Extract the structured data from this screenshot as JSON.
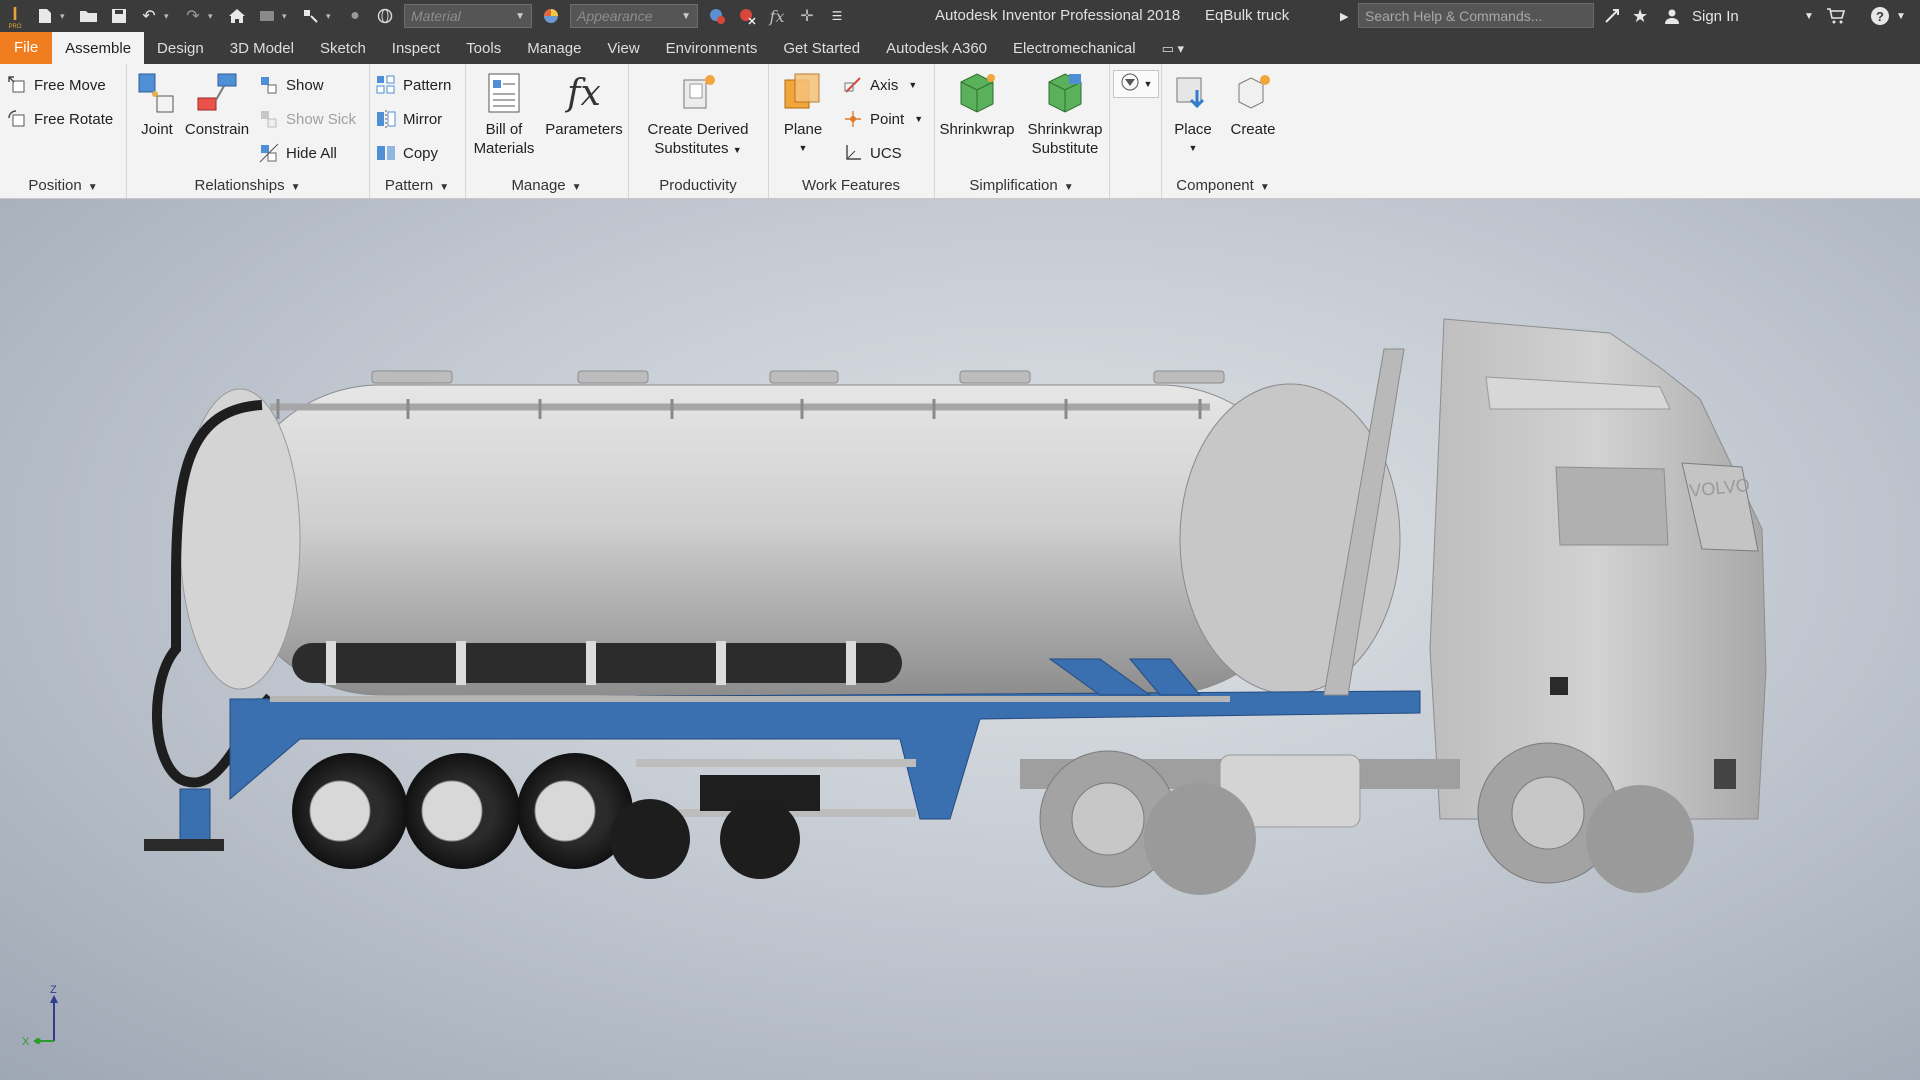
{
  "titlebar": {
    "app_title": "Autodesk Inventor Professional 2018",
    "doc_name": "EqBulk truck",
    "material_placeholder": "Material",
    "appearance_placeholder": "Appearance",
    "search_placeholder": "Search Help & Commands...",
    "sign_in": "Sign In",
    "logo_text": "PRO"
  },
  "tabs": [
    {
      "label": "File"
    },
    {
      "label": "Assemble"
    },
    {
      "label": "Design"
    },
    {
      "label": "3D Model"
    },
    {
      "label": "Sketch"
    },
    {
      "label": "Inspect"
    },
    {
      "label": "Tools"
    },
    {
      "label": "Manage"
    },
    {
      "label": "View"
    },
    {
      "label": "Environments"
    },
    {
      "label": "Get Started"
    },
    {
      "label": "Autodesk A360"
    },
    {
      "label": "Electromechanical"
    }
  ],
  "ribbon": {
    "position": {
      "title": "Position",
      "free_move": "Free Move",
      "free_rotate": "Free Rotate"
    },
    "relationships": {
      "title": "Relationships",
      "joint": "Joint",
      "constrain": "Constrain",
      "show": "Show",
      "show_sick": "Show Sick",
      "hide_all": "Hide All"
    },
    "pattern": {
      "title": "Pattern",
      "pattern": "Pattern",
      "mirror": "Mirror",
      "copy": "Copy"
    },
    "manage": {
      "title": "Manage",
      "bom_line1": "Bill of",
      "bom_line2": "Materials",
      "parameters": "Parameters"
    },
    "productivity": {
      "title": "Productivity",
      "cds_line1": "Create Derived",
      "cds_line2": "Substitutes"
    },
    "work_features": {
      "title": "Work Features",
      "plane": "Plane",
      "axis": "Axis",
      "point": "Point",
      "ucs": "UCS"
    },
    "simplification": {
      "title": "Simplification",
      "shrinkwrap": "Shrinkwrap",
      "sws_line1": "Shrinkwrap",
      "sws_line2": "Substitute"
    },
    "component": {
      "title": "Component",
      "place": "Place",
      "create": "Create"
    }
  },
  "viewport": {
    "truck_brand": "VOLVO",
    "axis_z": "Z",
    "axis_x": "X"
  },
  "colors": {
    "titlebar_bg": "#3b3b3b",
    "file_tab": "#f07d1f",
    "ribbon_bg": "#f3f3f3",
    "chassis_blue": "#3a6fb0",
    "tank_grey": "#c9c9c9"
  }
}
